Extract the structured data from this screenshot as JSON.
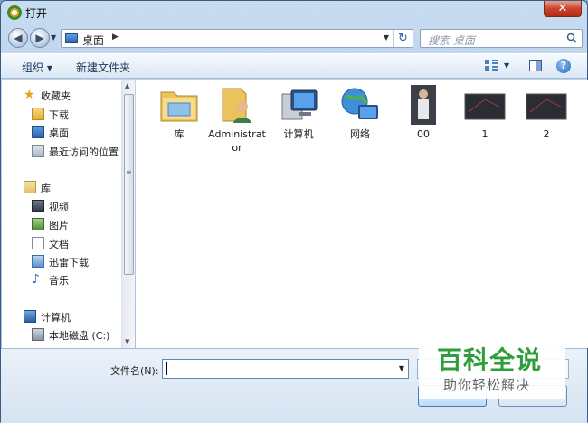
{
  "window": {
    "title": "打开",
    "close_label": "✕"
  },
  "navbar": {
    "back_label": "◀",
    "forward_label": "▶",
    "address": "桌面",
    "address_chevron": "▶",
    "dropdown": "▼",
    "refresh_label": "↻",
    "search_placeholder": "搜索 桌面"
  },
  "toolbar": {
    "organize": "组织 ▾",
    "new_folder": "新建文件夹",
    "view_dropdown": "▼",
    "help": "?"
  },
  "sidebar": {
    "items": [
      {
        "label": "收藏夹",
        "icon": "star-icon",
        "level": 0
      },
      {
        "label": "下载",
        "icon": "download-folder-icon",
        "level": 1
      },
      {
        "label": "桌面",
        "icon": "desktop-icon",
        "level": 1
      },
      {
        "label": "最近访问的位置",
        "icon": "recent-places-icon",
        "level": 1
      },
      {
        "label": "库",
        "icon": "library-icon",
        "level": 0
      },
      {
        "label": "视频",
        "icon": "video-icon",
        "level": 1
      },
      {
        "label": "图片",
        "icon": "picture-icon",
        "level": 1
      },
      {
        "label": "文档",
        "icon": "document-icon",
        "level": 1
      },
      {
        "label": "迅雷下载",
        "icon": "xunlei-download-icon",
        "level": 1
      },
      {
        "label": "音乐",
        "icon": "music-icon",
        "level": 1
      },
      {
        "label": "计算机",
        "icon": "computer-icon",
        "level": 0
      },
      {
        "label": "本地磁盘 (C:)",
        "icon": "local-disk-icon",
        "level": 1
      }
    ],
    "scroll_grip": "≡",
    "scroll_up": "▲",
    "scroll_down": "▼"
  },
  "files": [
    {
      "name": "库",
      "icon": "library-folder-icon"
    },
    {
      "name": "Administrator",
      "icon": "user-folder-icon"
    },
    {
      "name": "计算机",
      "icon": "computer-icon"
    },
    {
      "name": "网络",
      "icon": "network-icon"
    },
    {
      "name": "00",
      "icon": "photo-thumbnail-icon"
    },
    {
      "name": "1",
      "icon": "dark-image-thumbnail-icon"
    },
    {
      "name": "2",
      "icon": "dark-image-thumbnail-icon"
    }
  ],
  "bottom": {
    "filename_label": "文件名(N):",
    "filename_value": "",
    "dropdown": "▼"
  },
  "watermark": {
    "title": "百科全说",
    "subtitle": "助你轻松解决"
  },
  "colors": {
    "accent": "#2b64b6",
    "watermark_green": "#2e9d3a"
  }
}
